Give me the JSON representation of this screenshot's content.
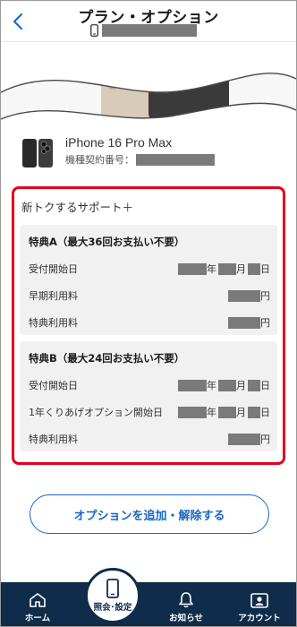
{
  "header": {
    "title": "プラン・オプション",
    "back_icon": "chevron-left-icon",
    "phone_icon": "smartphone-icon"
  },
  "product": {
    "name": "iPhone 16 Pro Max",
    "contract_label": "機種契約番号："
  },
  "support": {
    "title": "新トクするサポート＋",
    "benefit_a": {
      "title": "特典A（最大36回お支払い不要）",
      "rows": [
        {
          "label": "受付開始日",
          "type": "date"
        },
        {
          "label": "早期利用料",
          "type": "yen"
        },
        {
          "label": "特典利用料",
          "type": "yen"
        }
      ]
    },
    "benefit_b": {
      "title": "特典B（最大24回お支払い不要）",
      "rows": [
        {
          "label": "受付開始日",
          "type": "date"
        },
        {
          "label": "1年くりあげオプション開始日",
          "type": "date"
        },
        {
          "label": "特典利用料",
          "type": "yen"
        }
      ]
    },
    "units": {
      "year": "年",
      "month": "月",
      "day": "日",
      "yen": "円"
    }
  },
  "cta": {
    "label": "オプションを追加・解除する"
  },
  "nav": {
    "home": "ホーム",
    "inquiry": "照会･設定",
    "news": "お知らせ",
    "account": "アカウント"
  },
  "colors": {
    "accent": "#1667c2",
    "highlight_border": "#e3001b",
    "nav_bg": "#0f2d4b"
  }
}
